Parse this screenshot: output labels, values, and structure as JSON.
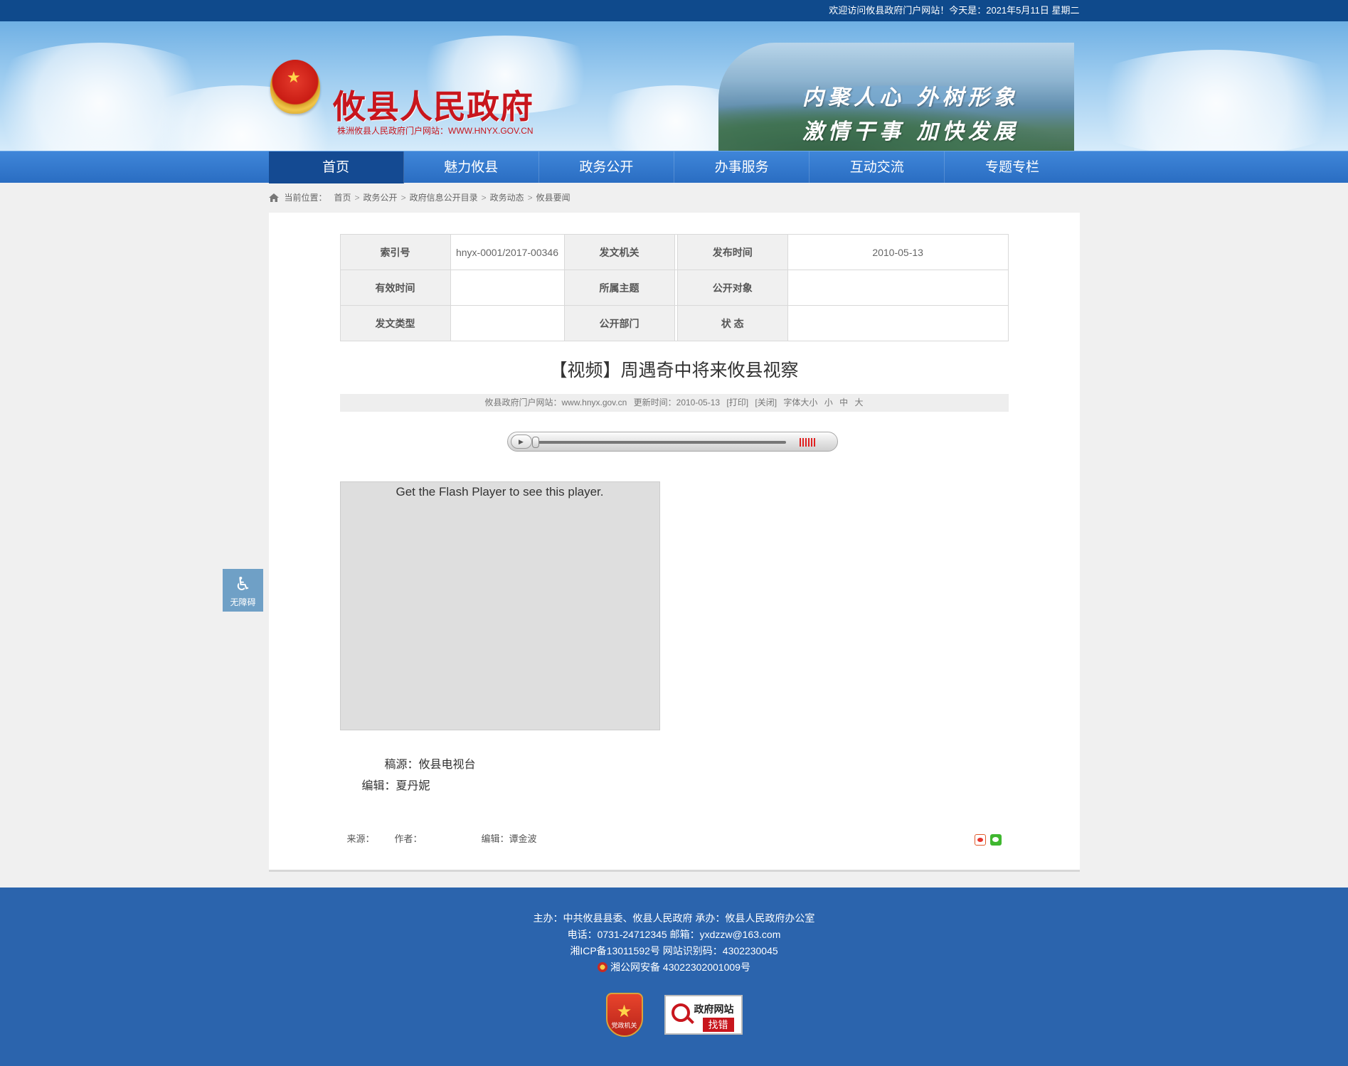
{
  "topbar": {
    "welcome": "欢迎访问攸县政府门户网站！今天是：2021年5月11日 星期二"
  },
  "header": {
    "site_title": "攸县人民政府",
    "site_subtitle": "株洲攸县人民政府门户网站：WWW.HNYX.GOV.CN",
    "slogan_line1": "内聚人心 外树形象",
    "slogan_line2": "激情干事 加快发展"
  },
  "nav": {
    "items": [
      {
        "label": "首页",
        "active": true
      },
      {
        "label": "魅力攸县"
      },
      {
        "label": "政务公开"
      },
      {
        "label": "办事服务"
      },
      {
        "label": "互动交流"
      },
      {
        "label": "专题专栏"
      }
    ]
  },
  "breadcrumb": {
    "label": "当前位置：",
    "items": [
      "首页",
      "政务公开",
      "政府信息公开目录",
      "政务动态",
      "攸县要闻"
    ],
    "separator": ">"
  },
  "meta": {
    "row1": {
      "l1": "索引号",
      "v1": "hnyx-0001/2017-00346",
      "l2": "发文机关",
      "v2": "",
      "l3": "发布时间",
      "v3": "2010-05-13"
    },
    "row2": {
      "l1": "有效时间",
      "v1": "",
      "l2": "所属主题",
      "v2": "",
      "l3": "公开对象",
      "v3": ""
    },
    "row3": {
      "l1": "发文类型",
      "v1": "",
      "l2": "公开部门",
      "v2": "",
      "l3": "状 态",
      "v3": ""
    }
  },
  "article": {
    "title": "【视频】周遇奇中将来攸县视察",
    "info_site": "攸县政府门户网站：www.hnyx.gov.cn",
    "info_time": "更新时间：2010-05-13",
    "print_label": "[打印]",
    "close_label": "[关闭]",
    "font_label": "字体大小",
    "font_small": "小",
    "font_medium": "中",
    "font_large": "大",
    "flash_notice": "Get the Flash Player to see this player.",
    "source_credit": "稿源：攸县电视台",
    "editor_credit": "编辑：夏丹妮",
    "footer_source": "来源：",
    "footer_author": "作者：",
    "footer_editor": "编辑：谭金波"
  },
  "player": {
    "play_icon": "play-icon",
    "progress": 0
  },
  "accessibility": {
    "label": "无障碍",
    "icon": "wheelchair-icon"
  },
  "footer": {
    "line1": "主办：中共攸县县委、攸县人民政府 承办：攸县人民政府办公室",
    "line2": "电话：0731-24712345 邮箱：yxdzzw@163.com",
    "line3": "湘ICP备13011592号   网站识别码：4302230045",
    "line4": "湘公网安备 43022302001009号",
    "badge_party_text": "党政机关",
    "badge_findbug_line1": "政府网站",
    "badge_findbug_line2": "找错"
  },
  "colors": {
    "brand_red": "#c8161d",
    "nav_blue": "#2a6dc2",
    "nav_active": "#144a92",
    "footer_blue": "#2b64ad"
  }
}
